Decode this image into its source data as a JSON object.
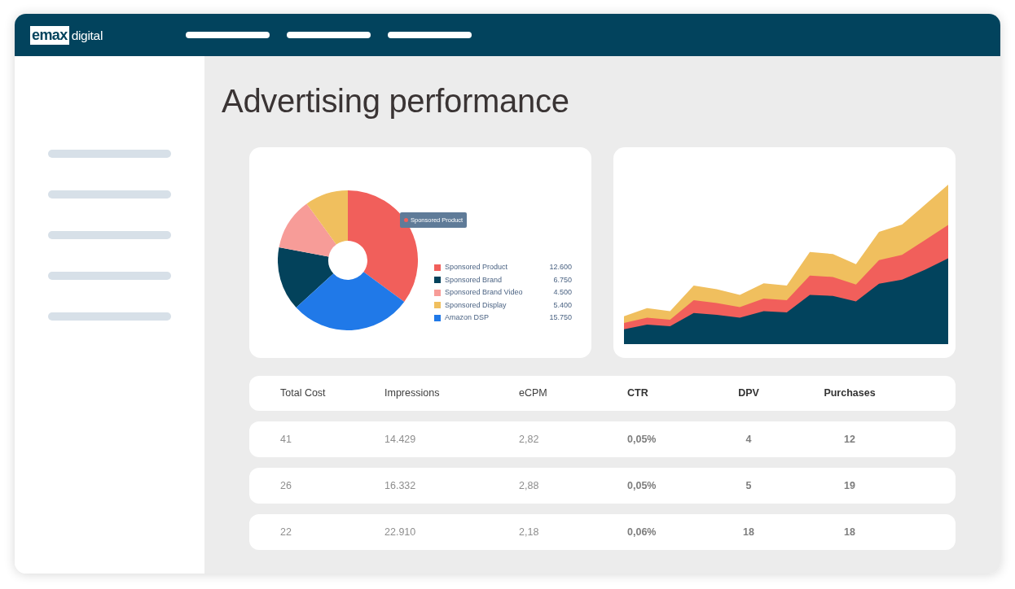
{
  "header": {
    "logo": {
      "mark": "emax",
      "text": "digital"
    }
  },
  "page_title": "Advertising performance",
  "spend_chart": {
    "chart_data": {
      "type": "donut",
      "categories": [
        "Sponsored Product",
        "Sponsored Brand",
        "Sponsored Brand Video",
        "Sponsored Display",
        "Amazon DSP"
      ],
      "values": [
        35.1,
        14.8,
        12.0,
        10.0,
        28.1
      ],
      "legend": "right"
    },
    "legend": [
      {
        "value": "12.600",
        "color": "#f15f5b"
      },
      {
        "value": "6.750",
        "color": "#03425b"
      },
      {
        "value": "4.500",
        "color": "#f79c98"
      },
      {
        "value": "5.400",
        "color": "#f0bf5e"
      },
      {
        "value": "15.750",
        "color": "#2079e8"
      }
    ],
    "tooltip": {
      "label": "Sponsored Product",
      "color": "#f15f5b"
    }
  },
  "table": {
    "columns": [
      "Total Cost",
      "Impressions",
      "eCPM",
      "CTR",
      "DPV",
      "Purchases"
    ],
    "rows": [
      [
        "41",
        "14.429",
        "2,82",
        "0,05%",
        "4",
        "12"
      ],
      [
        "26",
        "16.332",
        "2,88",
        "0,05%",
        "5",
        "19"
      ],
      [
        "22",
        "22.910",
        "2,18",
        "0,06%",
        "18",
        "18"
      ]
    ]
  }
}
